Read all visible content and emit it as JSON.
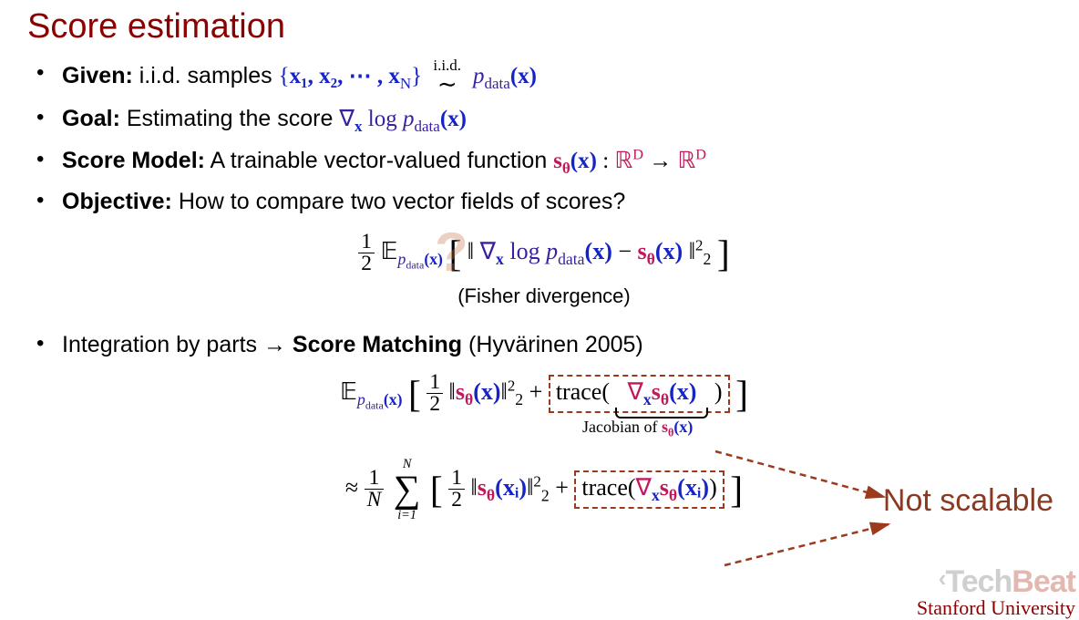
{
  "title": "Score estimation",
  "bullets": {
    "given_label": "Given:",
    "given_text": " i.i.d. samples ",
    "given_set_open": "{",
    "given_set_inside": "x₁, x₂, ⋯ , x",
    "given_set_N": "N",
    "given_set_close": "}",
    "given_iid_top": "i.i.d.",
    "given_iid_sym": "∼",
    "given_pdata": "p",
    "given_data_sub": "data",
    "given_x_in_p": "(x)",
    "goal_label": "Goal:",
    "goal_text": " Estimating the score ",
    "goal_grad": "∇",
    "goal_grad_sub": "x",
    "goal_log": " log ",
    "goal_pdata": "p",
    "goal_data_sub": "data",
    "goal_x": "(x)",
    "model_label": "Score Model:",
    "model_text": " A trainable vector-valued function  ",
    "model_s": "s",
    "model_theta": "θ",
    "model_x": "(x)",
    "model_colon": " : ",
    "model_R1": "ℝ",
    "model_D1": "D",
    "model_arrow": " → ",
    "model_R2": "ℝ",
    "model_D2": "D",
    "obj_label": "Objective:",
    "obj_text": " How to compare two vector fields of scores?",
    "sm_text1": "Integration by parts → ",
    "sm_text2": "Score Matching ",
    "sm_text3": "(Hyvärinen 2005)"
  },
  "equations": {
    "half_num": "1",
    "half_den": "2",
    "E": "𝔼",
    "p": "p",
    "data": "data",
    "x": "(x)",
    "lbrack": "[",
    "rbrack": "]",
    "norm_open": "‖",
    "grad": "∇",
    "grad_sub": "x",
    "log": " log ",
    "minus": " − ",
    "s": "s",
    "theta": "θ",
    "norm_close": "‖",
    "norm_subsup": "2",
    "norm_exp": "2",
    "fisher_caption": "(Fisher divergence)",
    "plus": " + ",
    "trace": "trace(",
    "trace_close": ")",
    "jac_label": "Jacobian of ",
    "approx": "≈",
    "one": "1",
    "N": "N",
    "sum_top": "N",
    "sum_sym": "∑",
    "sum_bot": "i=1",
    "xi": "(xᵢ)",
    "annotation": "Not scalable"
  },
  "watermark": {
    "tech": "Tech",
    "beat": "Beat",
    "stanford": "Stanford University"
  }
}
